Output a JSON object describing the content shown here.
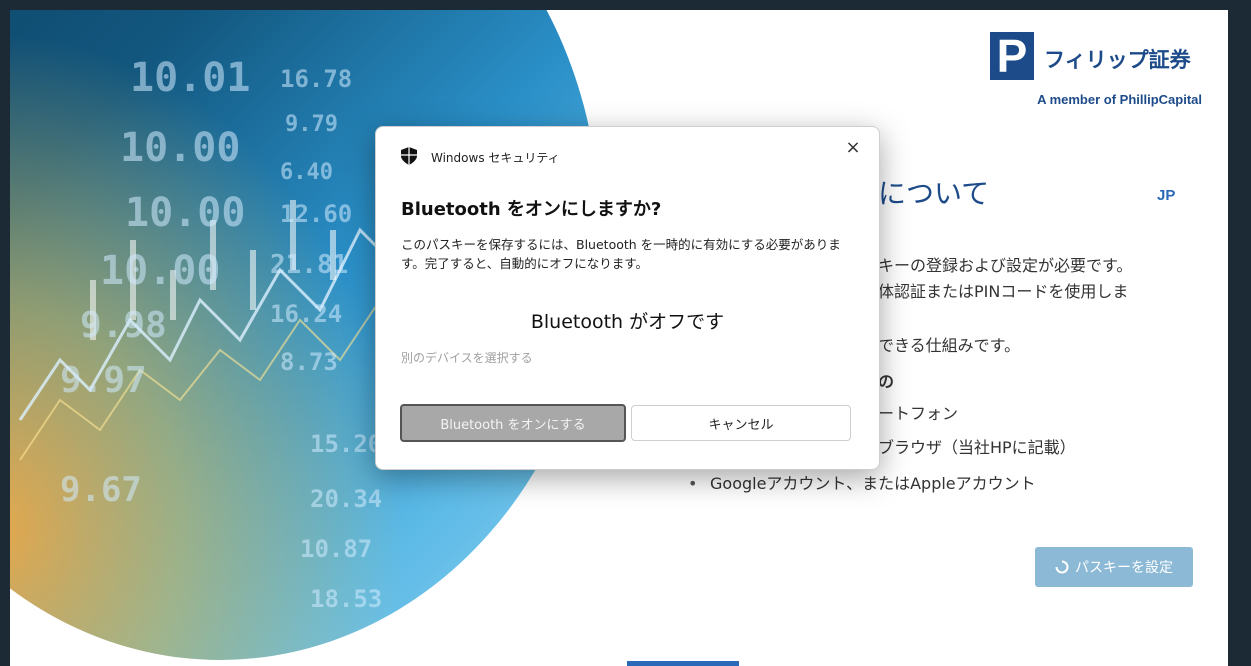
{
  "background": {
    "ticker_numbers": [
      "10.01",
      "16.78",
      "10.00",
      "9.79",
      "6.40",
      "10.00",
      "12.60",
      "10.00",
      "21.81",
      "9.98",
      "16.24",
      "8.73",
      "9.97",
      "15.20",
      "9.67",
      "20.34",
      "10.87",
      "18.53"
    ]
  },
  "logo": {
    "mark": "P",
    "name": "フィリップ証券",
    "tagline": "A member of PhillipCapital"
  },
  "page": {
    "heading_fragment": "について",
    "language": "JP",
    "lines": [
      "キーの登録および設定が必要です。",
      "体認証またはPINコードを使用しま",
      "できる仕組みです。",
      "の",
      "ートフォン",
      "ブラウザ（当社HPに記載）"
    ],
    "bullet_item": "Googleアカウント、またはAppleアカウント",
    "setup_button": "パスキーを設定"
  },
  "dialog": {
    "app_name": "Windows セキュリティ",
    "close_glyph": "×",
    "title": "Bluetooth をオンにしますか?",
    "body": "このパスキーを保存するには、Bluetooth を一時的に有効にする必要があります。完了すると、自動的にオフになります。",
    "status": "Bluetooth がオフです",
    "alt_device_link": "別のデバイスを選択する",
    "primary_button": "Bluetooth をオンにする",
    "cancel_button": "キャンセル"
  },
  "colors": {
    "brand": "#1d4b8a",
    "accent": "#2a69b8",
    "setup_button_bg": "#8cb9d6",
    "dialog_primary_bg": "#a8a8a8"
  }
}
